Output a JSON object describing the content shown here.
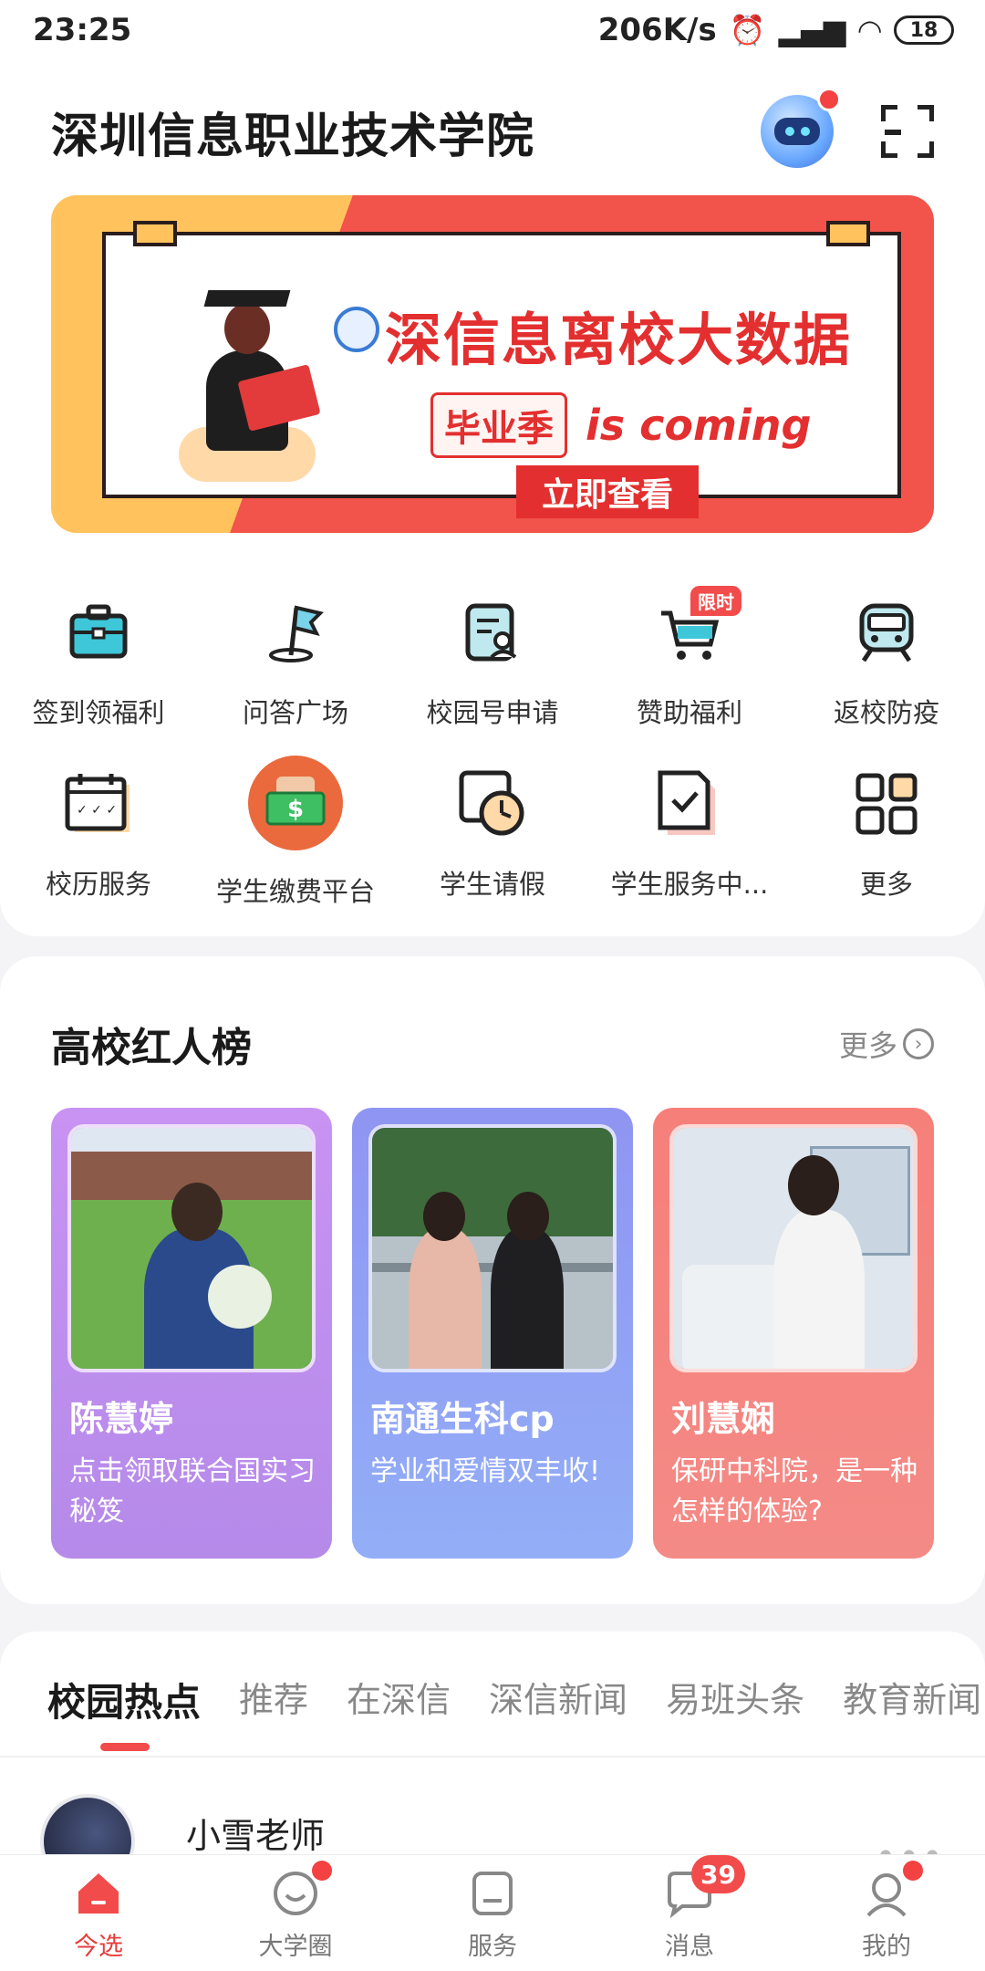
{
  "status_bar": {
    "time": "23:25",
    "network_speed": "206K/s",
    "battery": "18"
  },
  "header": {
    "title": "深圳信息职业技术学院"
  },
  "banner": {
    "title": "深信息离校大数据",
    "tag": "毕业季",
    "slogan": "is coming",
    "cta": "立即查看"
  },
  "grid": {
    "items": [
      {
        "label": "签到领福利",
        "icon": "briefcase-icon"
      },
      {
        "label": "问答广场",
        "icon": "flag-icon"
      },
      {
        "label": "校园号申请",
        "icon": "id-card-icon"
      },
      {
        "label": "赞助福利",
        "icon": "cart-icon",
        "badge": "限时"
      },
      {
        "label": "返校防疫",
        "icon": "train-icon"
      },
      {
        "label": "校历服务",
        "icon": "calendar-icon"
      },
      {
        "label": "学生缴费平台",
        "icon": "payment-icon"
      },
      {
        "label": "学生请假",
        "icon": "clock-icon"
      },
      {
        "label": "学生服务中...",
        "icon": "document-check-icon"
      },
      {
        "label": "更多",
        "icon": "grid-icon"
      }
    ]
  },
  "ranking": {
    "title": "高校红人榜",
    "more": "更多",
    "cards": [
      {
        "name": "陈慧婷",
        "desc": "点击领取联合国实习秘笈",
        "color": "#c38ef0"
      },
      {
        "name": "南通生科cp",
        "desc": "学业和爱情双丰收!",
        "color": "#8fa6f5"
      },
      {
        "name": "刘慧娴",
        "desc": "保研中科院，是一种怎样的体验?",
        "color": "#f67f7a"
      }
    ]
  },
  "news": {
    "tabs": [
      "校园热点",
      "推荐",
      "在深信",
      "深信新闻",
      "易班头条",
      "教育新闻"
    ],
    "active_tab": 0,
    "author": "小雪老师"
  },
  "bottom_nav": {
    "items": [
      {
        "label": "今选",
        "active": true
      },
      {
        "label": "大学圈",
        "dot": true
      },
      {
        "label": "服务"
      },
      {
        "label": "消息",
        "badge": "39"
      },
      {
        "label": "我的",
        "dot": true
      }
    ]
  },
  "colors": {
    "accent": "#f24b4b",
    "banner_red": "#e32f2f",
    "banner_yellow": "#ffc25c"
  }
}
